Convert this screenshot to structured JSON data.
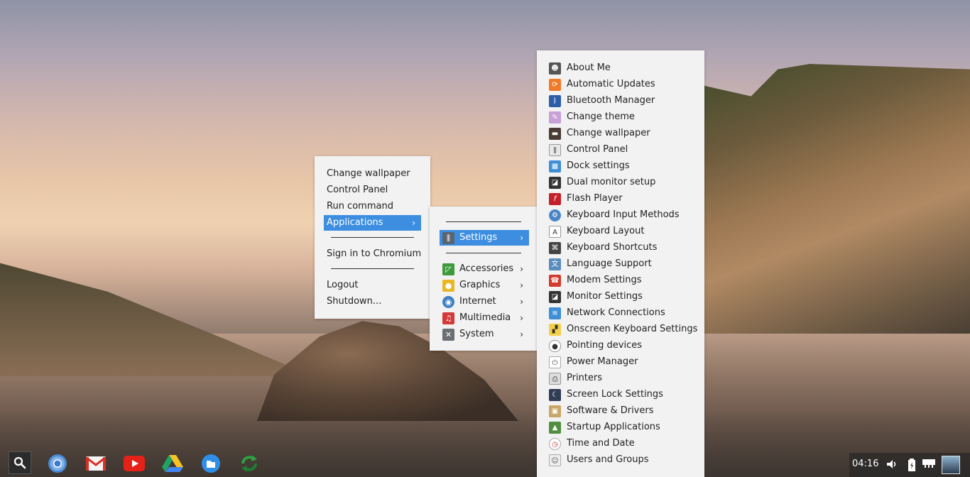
{
  "main_menu": {
    "items": [
      "Change wallpaper",
      "Control Panel",
      "Run command"
    ],
    "applications_label": "Applications",
    "sign_in_label": "Sign in to Chromium",
    "logout_label": "Logout",
    "shutdown_label": "Shutdown..."
  },
  "applications_menu": {
    "settings_label": "Settings",
    "categories": [
      "Accessories",
      "Graphics",
      "Internet",
      "Multimedia",
      "System"
    ]
  },
  "settings_menu": {
    "items": [
      "About Me",
      "Automatic Updates",
      "Bluetooth Manager",
      "Change theme",
      "Change wallpaper",
      "Control Panel",
      "Dock settings",
      "Dual monitor setup",
      "Flash Player",
      "Keyboard Input Methods",
      "Keyboard Layout",
      "Keyboard Shortcuts",
      "Language Support",
      "Modem Settings",
      "Monitor Settings",
      "Network Connections",
      "Onscreen Keyboard Settings",
      "Pointing devices",
      "Power Manager",
      "Printers",
      "Screen Lock Settings",
      "Software & Drivers",
      "Startup Applications",
      "Time and Date",
      "Users and Groups"
    ]
  },
  "tray": {
    "time": "04:16"
  },
  "colors": {
    "menu_bg": "#f2f2f2",
    "highlight": "#3d8ee0"
  },
  "icons": {
    "taskbar": [
      "search-icon",
      "chromium-icon",
      "gmail-icon",
      "youtube-icon",
      "drive-icon",
      "files-icon",
      "sync-icon"
    ],
    "tray": [
      "volume-icon",
      "battery-icon",
      "network-icon",
      "user-avatar"
    ]
  }
}
